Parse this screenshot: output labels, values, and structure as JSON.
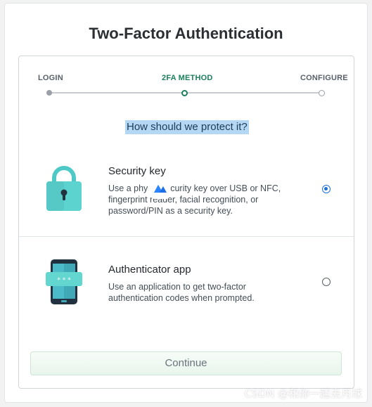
{
  "dialog": {
    "title": "Two-Factor Authentication"
  },
  "steps": [
    {
      "label": "LOGIN",
      "state": "done"
    },
    {
      "label": "2FA METHOD",
      "state": "active"
    },
    {
      "label": "CONFIGURE",
      "state": "pending"
    }
  ],
  "question": "How should we protect it?",
  "options": [
    {
      "title": "Security key",
      "description_lines": [
        "Use a phy   security key over USB or NFC,",
        "fingerprint reader, facial recognition, or",
        "password/PIN as a security key."
      ],
      "selected": true,
      "icon": "padlock-icon"
    },
    {
      "title": "Authenticator app",
      "description_lines": [
        "Use an application to get two-factor",
        "authentication codes when prompted."
      ],
      "selected": false,
      "icon": "phone-password-icon"
    }
  ],
  "continue_label": "Continue",
  "watermark": "CSDN @和你一起去月球",
  "colors": {
    "accent_green": "#1a7f5a",
    "radio_blue": "#1e6fd9",
    "teal": "#4fc9c8",
    "highlight": "#b4d7f4"
  }
}
